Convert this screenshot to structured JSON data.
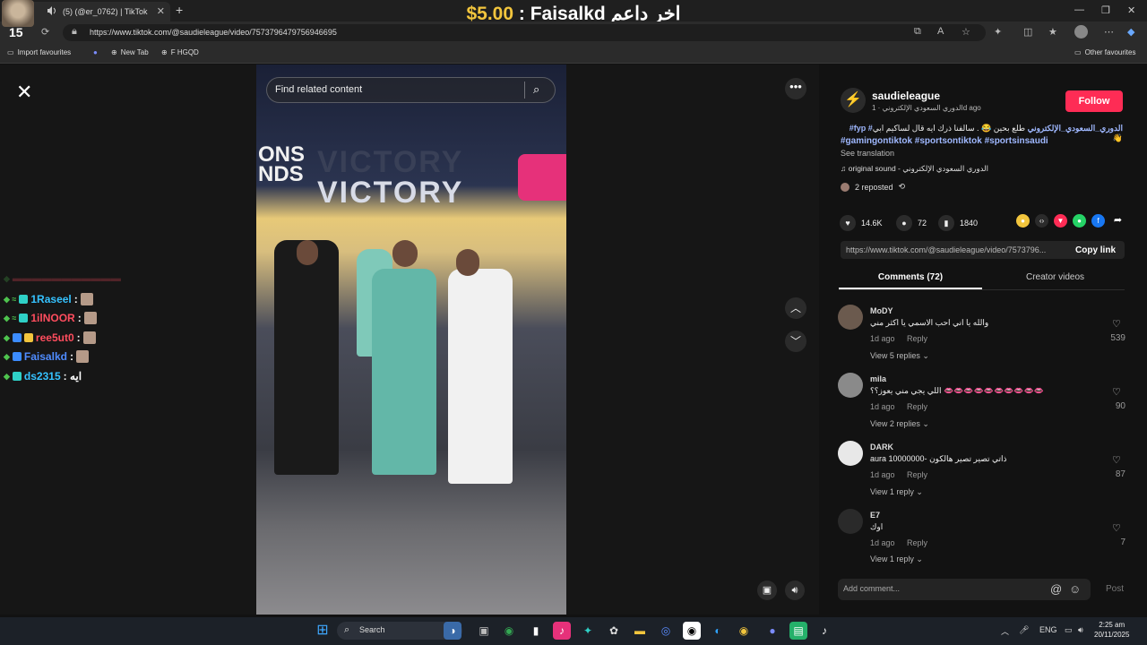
{
  "browser": {
    "tab_title": "(5) (@er_0762) | TikTok",
    "url": "https://www.tiktok.com/@saudieleague/video/7573796479756946695",
    "bookmarks": [
      "Import favourites",
      "New Tab",
      "F HGQD"
    ],
    "other_favourites": "Other favourites"
  },
  "stream_overlay": {
    "donation_amount": "$5.00",
    "donation_text": ": Faisalkd اخر داعم",
    "badge_number": "15"
  },
  "chat": [
    {
      "user": "1Raseel",
      "msg": ":",
      "color": "#35c2ff"
    },
    {
      "user": "1ilNOOR",
      "msg": ":",
      "color": "#ff4d5e"
    },
    {
      "user": "ree5ut0",
      "msg": ":",
      "color": "#ff4d5e"
    },
    {
      "user": "Faisalkd",
      "msg": ":",
      "color": "#4f8cff"
    },
    {
      "user": "ds2315",
      "msg": ": ايه",
      "color": "#35c2ff"
    }
  ],
  "viewer": {
    "search_placeholder": "Find related content",
    "close_icon": "close-icon",
    "stage_text": "VICTORY",
    "stage_text_left": "ONS\nNDS"
  },
  "post": {
    "username": "saudieleague",
    "subtitle": "الدوري السعودي الإلكتروني · 1d ago",
    "follow_label": "Follow",
    "description": "طلع بحين 😂 . سالفنا ذرك ايه قال لساكيم ابي 👋",
    "description_tags": "#fyp #الدوري_السعودي_الإلكتروني",
    "hashtags": "#gamingontiktok #sportsontiktok #sportsinsaudi",
    "see_translation": "See translation",
    "sound": "original sound - الدوري السعودي الإلكتروني",
    "reposted": "2 reposted",
    "likes": "14.6K",
    "comments_count": "72",
    "saves": "1840",
    "link": "https://www.tiktok.com/@saudieleague/video/7573796...",
    "copy_link": "Copy link",
    "tab_comments": "Comments (72)",
    "tab_creator": "Creator videos"
  },
  "comments": [
    {
      "user": "MoDY",
      "text": "والله يا اني احب الاسمي يا اكثر مني",
      "time": "1d ago",
      "reply": "Reply",
      "view": "View 5 replies",
      "likes": "539"
    },
    {
      "user": "mila",
      "text": "اللي يجي مني يعوز؟؟ 👄👄👄👄👄👄👄👄👄👄",
      "time": "1d ago",
      "reply": "Reply",
      "view": "View 2 replies",
      "likes": "90"
    },
    {
      "user": "DARK",
      "text": "aura 10000000- ذاتي تصير تصير هالكون",
      "time": "1d ago",
      "reply": "Reply",
      "view": "View 1 reply",
      "likes": "87"
    },
    {
      "user": "E7",
      "text": "اوك",
      "time": "1d ago",
      "reply": "Reply",
      "view": "View 1 reply",
      "likes": "7"
    }
  ],
  "comment_input": {
    "placeholder": "Add comment...",
    "post": "Post"
  },
  "taskbar": {
    "search": "Search",
    "lang": "ENG",
    "time": "2:25 am",
    "date": "20/11/2025"
  }
}
